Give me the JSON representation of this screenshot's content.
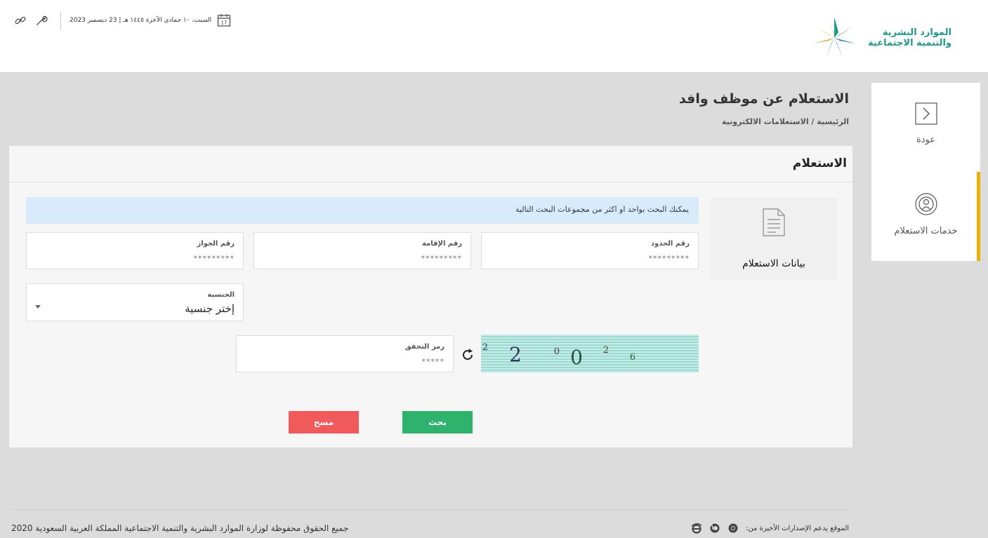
{
  "header": {
    "logo_line1": "الموارد البشرية",
    "logo_line2": "والتنمية الاجتماعية",
    "date": "السبت، ١٠ جمادى الآخرة ١٤٤٥ هـ | 23 ديسمبر 2023",
    "calendar_day": "17"
  },
  "sidebar": {
    "back_label": "عودة",
    "services_label": "خدمات الاستعلام"
  },
  "page": {
    "title": "الاستعلام عن موظف وافد",
    "breadcrumb": "الرئيسية / الاستعلامات الالكترونية"
  },
  "panel": {
    "title": "الاستعلام",
    "card_label": "بيانات الاستعلام",
    "info": "يمكنك البحث بواحد او اكثر من مجموعات البحث التالية",
    "fields": {
      "border_label": "رقم الحدود",
      "border_value": "*********",
      "iqama_label": "رقم الإقامة",
      "iqama_value": "*********",
      "passport_label": "رقم الجواز",
      "passport_value": "*********",
      "nationality_label": "الجنسية",
      "nationality_value": "إختر جنسية",
      "captcha_label": "رمز التحقق",
      "captcha_value": "*****"
    },
    "captcha_text": "20026",
    "search_label": "بحث",
    "clear_label": "مسح"
  },
  "footer": {
    "copyright": "جميع الحقوق محفوظة لوزارة الموارد البشرية والتنمية الاجتماعية المملكة العربية السعودية 2020",
    "support": "الموقع يدعم الإصدارات الأخيرة من:"
  },
  "colors": {
    "accent": "#f0b000",
    "search": "#2fb36c",
    "clear": "#f05a5a",
    "info": "#d9ebfa",
    "brand": "#1d9a8a"
  }
}
